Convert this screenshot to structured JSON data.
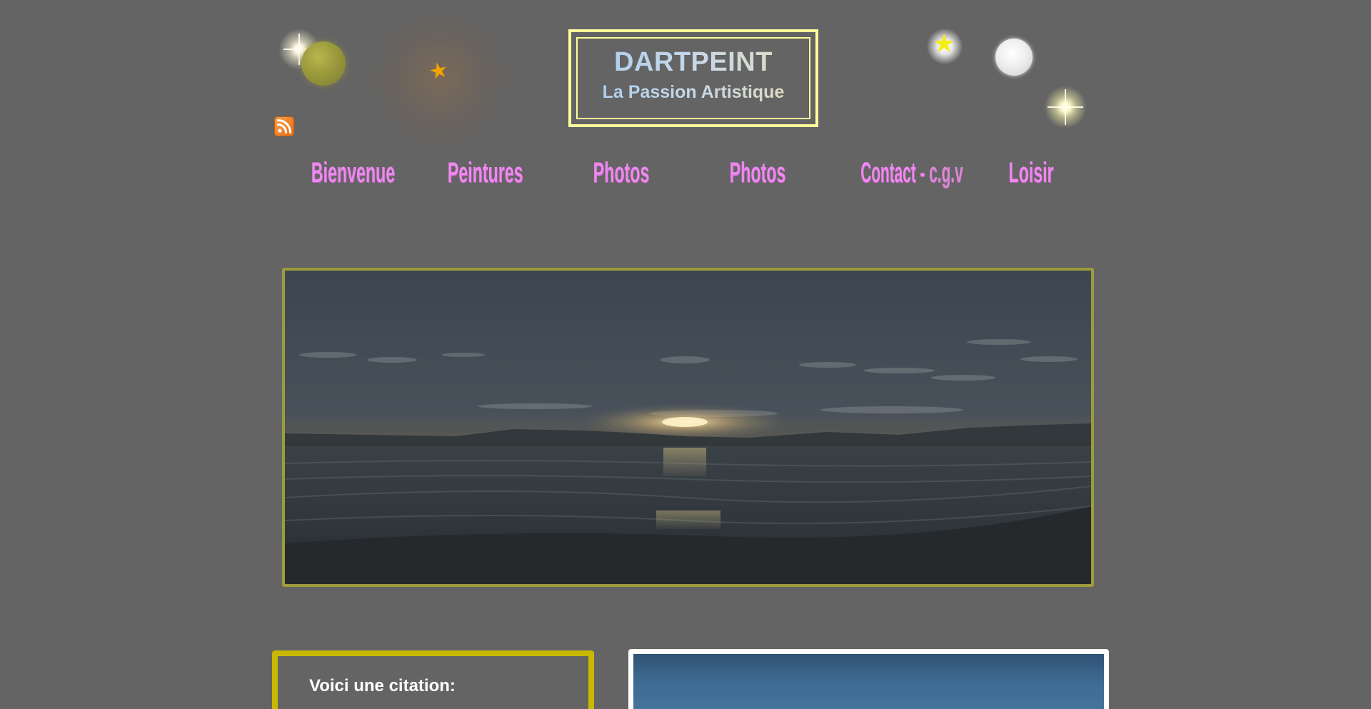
{
  "header": {
    "title": "DARTPEINT",
    "subtitle": "La Passion Artistique",
    "rss_icon": "rss-feed-icon"
  },
  "nav": {
    "items": [
      {
        "label": "Bienvenue"
      },
      {
        "label": "Peintures"
      },
      {
        "label": "Photos"
      },
      {
        "label": "Photos"
      },
      {
        "label": "Contact",
        "suffix": "c.g.v"
      },
      {
        "label": "Loisir"
      }
    ]
  },
  "banner": {
    "image": "sunset-over-sea-photo"
  },
  "quote": {
    "heading": "Voici une citation:"
  },
  "photo": {
    "image": "blue-sky-photo"
  },
  "colors": {
    "background": "#646464",
    "title_border": "#ffff99",
    "nav_text": "#ee88ee",
    "banner_border": "#9c9c3c",
    "quote_border": "#c9b800",
    "photo_border": "#ffffff"
  }
}
